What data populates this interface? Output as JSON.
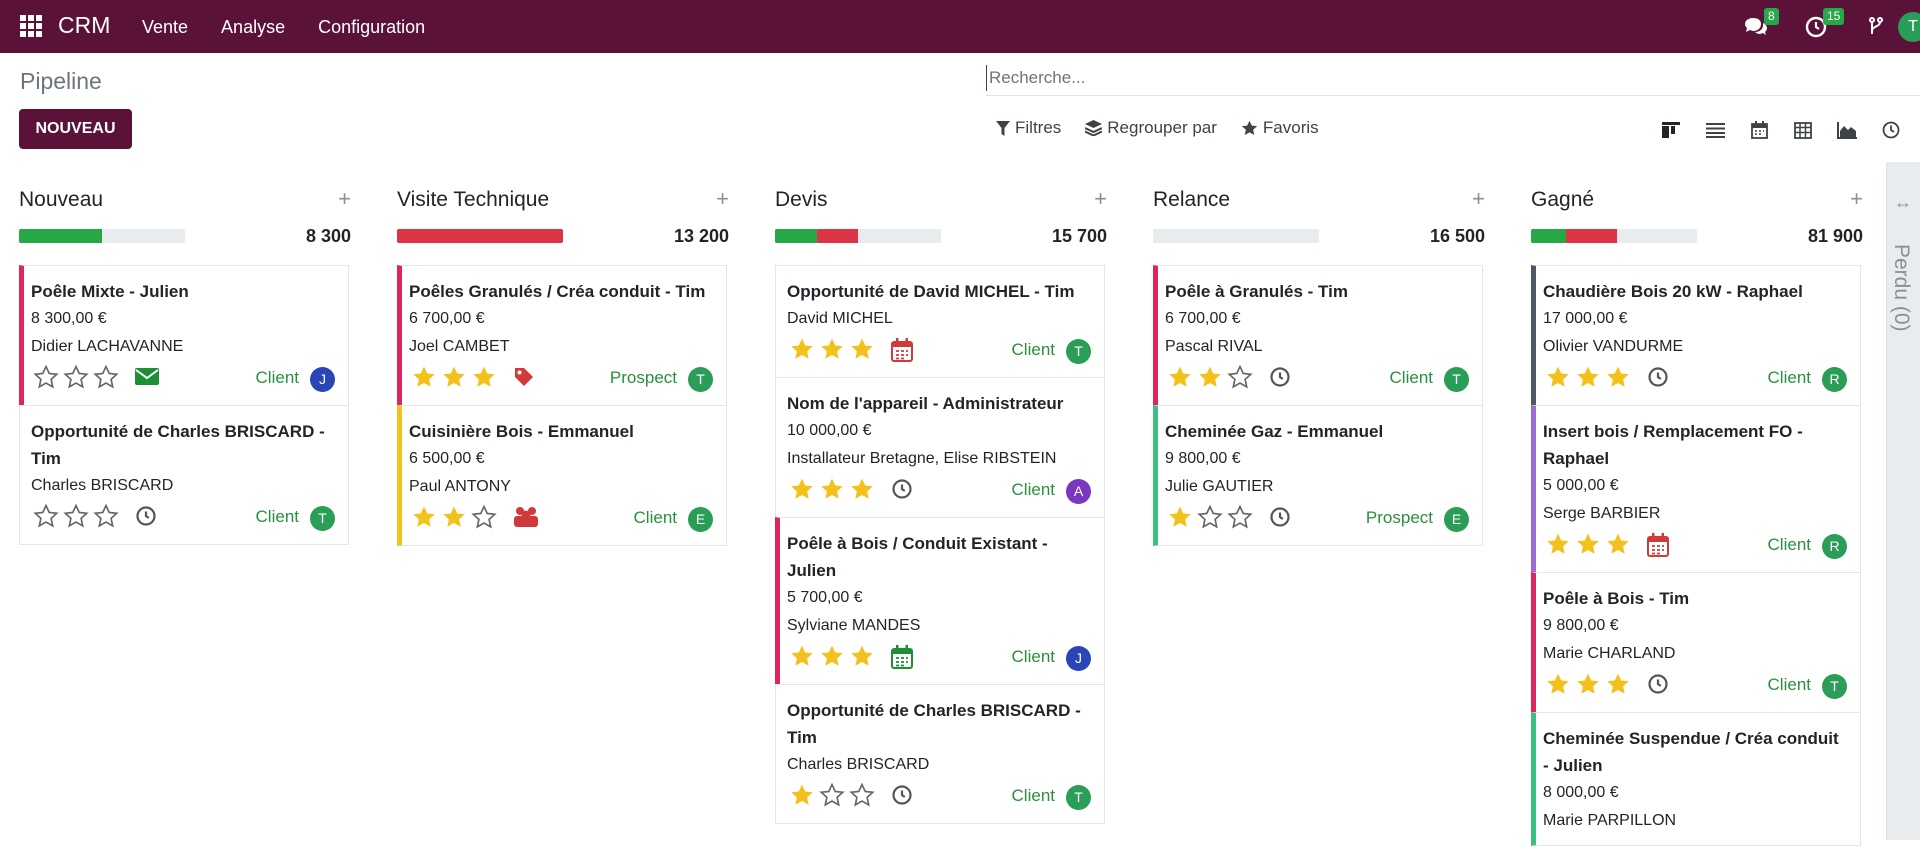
{
  "navbar": {
    "brand": "CRM",
    "menu": [
      "Vente",
      "Analyse",
      "Configuration"
    ],
    "messages_count": "8",
    "activities_count": "15",
    "user_initial": "T"
  },
  "control": {
    "breadcrumb": "Pipeline",
    "new_button": "NOUVEAU",
    "search_placeholder": "Recherche...",
    "filters": "Filtres",
    "group_by": "Regrouper par",
    "favorites": "Favoris"
  },
  "colors": {
    "primary": "#5b1238",
    "green": "#28a745",
    "red": "#dc3545",
    "star": "#f3c11b"
  },
  "columns": [
    {
      "title": "Nouveau",
      "total": "8 300",
      "progress": [
        {
          "color": "#28a745",
          "pct": 50
        }
      ],
      "cards": [
        {
          "title": "Poêle Mixte - Julien",
          "amount": "8 300,00 €",
          "partner": "Didier LACHAVANNE",
          "stars": 0,
          "activity": "envelope-icon",
          "tag": "Client",
          "avatar": "J",
          "avatar_color": "#2a45b8",
          "border": "#e0245e"
        },
        {
          "title": "Opportunité de Charles BRISCARD - Tim",
          "amount": "",
          "partner": "Charles BRISCARD",
          "stars": 0,
          "activity": "clock-icon",
          "tag": "Client",
          "avatar": "T",
          "avatar_color": "#2a9d57",
          "border": ""
        }
      ]
    },
    {
      "title": "Visite Technique",
      "total": "13 200",
      "progress": [
        {
          "color": "#dc3545",
          "pct": 100
        }
      ],
      "cards": [
        {
          "title": "Poêles Granulés / Créa conduit - Tim",
          "amount": "6 700,00 €",
          "partner": "Joel CAMBET",
          "stars": 3,
          "activity": "tag-icon",
          "tag": "Prospect",
          "avatar": "T",
          "avatar_color": "#2a9d57",
          "border": "#e0245e"
        },
        {
          "title": "Cuisinière Bois - Emmanuel",
          "amount": "6 500,00 €",
          "partner": "Paul ANTONY",
          "stars": 2,
          "activity": "users-icon",
          "tag": "Client",
          "avatar": "E",
          "avatar_color": "#2a9d57",
          "border": "#f3c11b"
        }
      ]
    },
    {
      "title": "Devis",
      "total": "15 700",
      "progress": [
        {
          "color": "#28a745",
          "pct": 25
        },
        {
          "color": "#dc3545",
          "pct": 25
        }
      ],
      "cards": [
        {
          "title": "Opportunité de David MICHEL - Tim",
          "amount": "",
          "partner": "David MICHEL",
          "stars": 3,
          "activity": "calendar-red-icon",
          "tag": "Client",
          "avatar": "T",
          "avatar_color": "#2a9d57",
          "border": ""
        },
        {
          "title": "Nom de l'appareil - Administrateur",
          "amount": "10 000,00 €",
          "partner": "Installateur Bretagne, Elise RIBSTEIN",
          "stars": 3,
          "activity": "clock-icon",
          "tag": "Client",
          "avatar": "A",
          "avatar_color": "#7b36c2",
          "border": ""
        },
        {
          "title": "Poêle à Bois / Conduit Existant - Julien",
          "amount": "5 700,00 €",
          "partner": "Sylviane MANDES",
          "stars": 3,
          "activity": "calendar-green-icon",
          "tag": "Client",
          "avatar": "J",
          "avatar_color": "#2a45b8",
          "border": "#e0245e"
        },
        {
          "title": "Opportunité de Charles BRISCARD - Tim",
          "amount": "",
          "partner": "Charles BRISCARD",
          "stars": 1,
          "activity": "clock-icon",
          "tag": "Client",
          "avatar": "T",
          "avatar_color": "#2a9d57",
          "border": ""
        }
      ]
    },
    {
      "title": "Relance",
      "total": "16 500",
      "progress": [],
      "cards": [
        {
          "title": "Poêle à Granulés - Tim",
          "amount": "6 700,00 €",
          "partner": "Pascal RIVAL",
          "stars": 2,
          "activity": "clock-icon",
          "tag": "Client",
          "avatar": "T",
          "avatar_color": "#2a9d57",
          "border": "#e0245e"
        },
        {
          "title": "Cheminée Gaz - Emmanuel",
          "amount": "9 800,00 €",
          "partner": "Julie GAUTIER",
          "stars": 1,
          "activity": "clock-icon",
          "tag": "Prospect",
          "avatar": "E",
          "avatar_color": "#2a9d57",
          "border": "#3bc082"
        }
      ]
    },
    {
      "title": "Gagné",
      "total": "81 900",
      "progress": [
        {
          "color": "#28a745",
          "pct": 21
        },
        {
          "color": "#dc3545",
          "pct": 31
        }
      ],
      "cards": [
        {
          "title": "Chaudière Bois 20 kW - Raphael",
          "amount": "17 000,00 €",
          "partner": "Olivier VANDURME",
          "stars": 3,
          "activity": "clock-icon",
          "tag": "Client",
          "avatar": "R",
          "avatar_color": "#2a9d57",
          "border": "#4d5866"
        },
        {
          "title": "Insert bois / Remplacement FO - Raphael",
          "amount": "5 000,00 €",
          "partner": "Serge BARBIER",
          "stars": 3,
          "activity": "calendar-red-icon",
          "tag": "Client",
          "avatar": "R",
          "avatar_color": "#2a9d57",
          "border": "#9c6bd0"
        },
        {
          "title": "Poêle à Bois - Tim",
          "amount": "9 800,00 €",
          "partner": "Marie CHARLAND",
          "stars": 3,
          "activity": "clock-icon",
          "tag": "Client",
          "avatar": "T",
          "avatar_color": "#2a9d57",
          "border": "#e0245e"
        },
        {
          "title": "Cheminée Suspendue / Créa conduit - Julien",
          "amount": "8 000,00 €",
          "partner": "Marie PARPILLON",
          "stars": 0,
          "activity": "",
          "tag": "",
          "avatar": "",
          "avatar_color": "#2a9d57",
          "border": "#3bc082"
        }
      ]
    }
  ],
  "folded_column": "Perdu (0)"
}
